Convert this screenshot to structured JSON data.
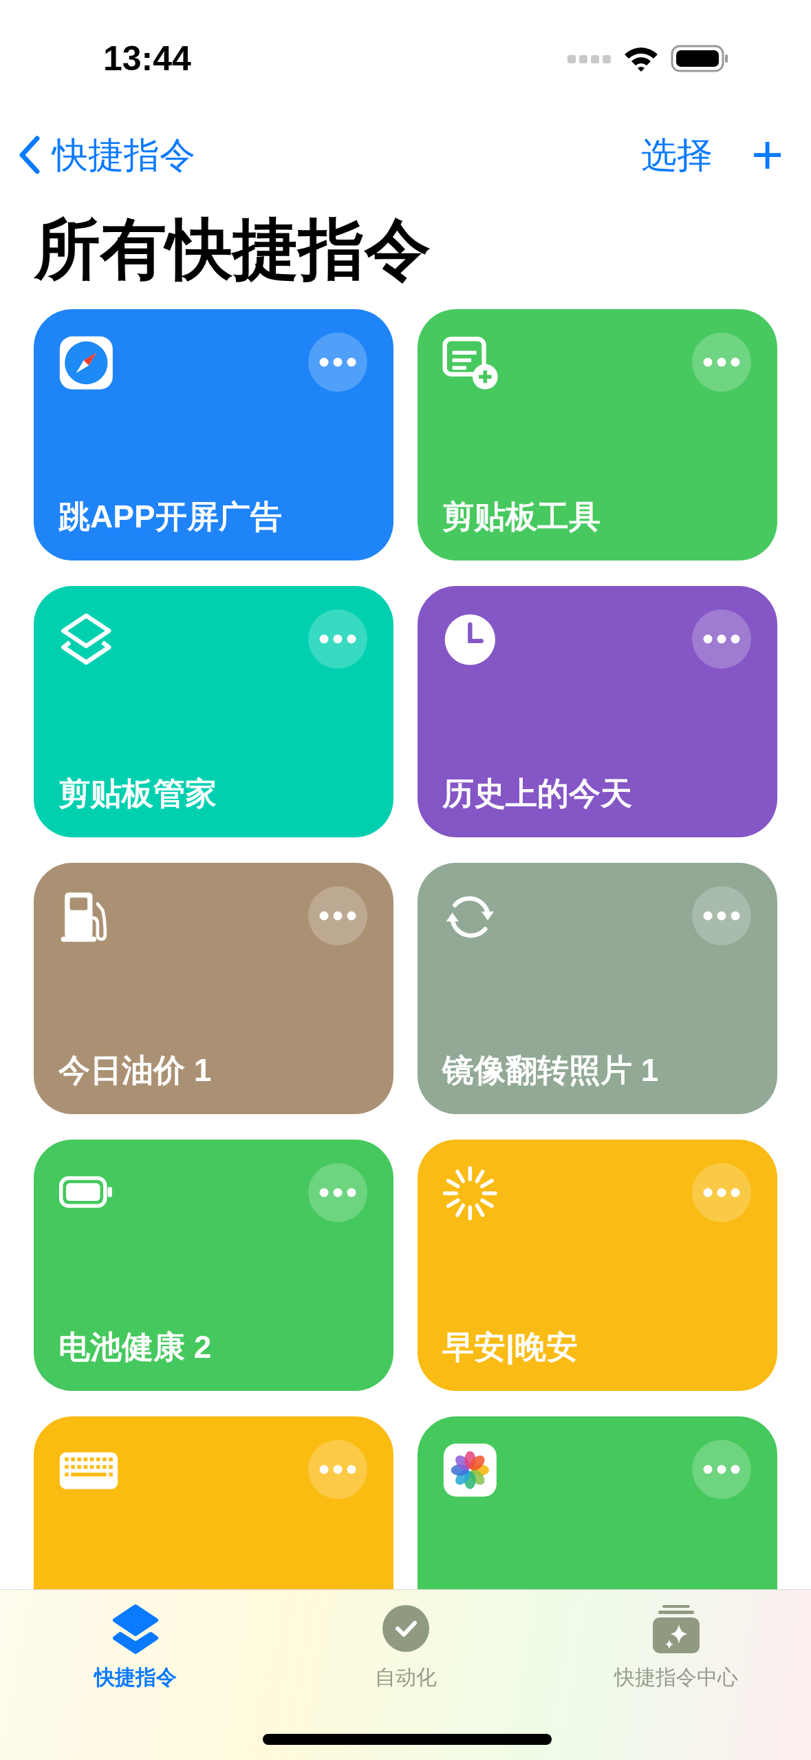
{
  "status_bar": {
    "time": "13:44"
  },
  "nav": {
    "back_label": "快捷指令",
    "select_label": "选择",
    "add_label": "+"
  },
  "title": "所有快捷指令",
  "shortcuts": [
    {
      "title": "跳APP开屏广告",
      "color": "#1f84f8"
    },
    {
      "title": "剪贴板工具",
      "color": "#47c95f"
    },
    {
      "title": "剪贴板管家",
      "color": "#00d0b0"
    },
    {
      "title": "历史上的今天",
      "color": "#8556c6"
    },
    {
      "title": "今日油价 1",
      "color": "#ab9174"
    },
    {
      "title": "镜像翻转照片 1",
      "color": "#91a995"
    },
    {
      "title": "电池健康 2",
      "color": "#45c85d"
    },
    {
      "title": "早安|晚安",
      "color": "#f9bb14"
    },
    {
      "color": "#fbbc12"
    },
    {
      "color": "#45c85c"
    }
  ],
  "tabs": [
    {
      "label": "快捷指令",
      "selected": true
    },
    {
      "label": "自动化",
      "selected": false
    },
    {
      "label": "快捷指令中心",
      "selected": false
    }
  ]
}
